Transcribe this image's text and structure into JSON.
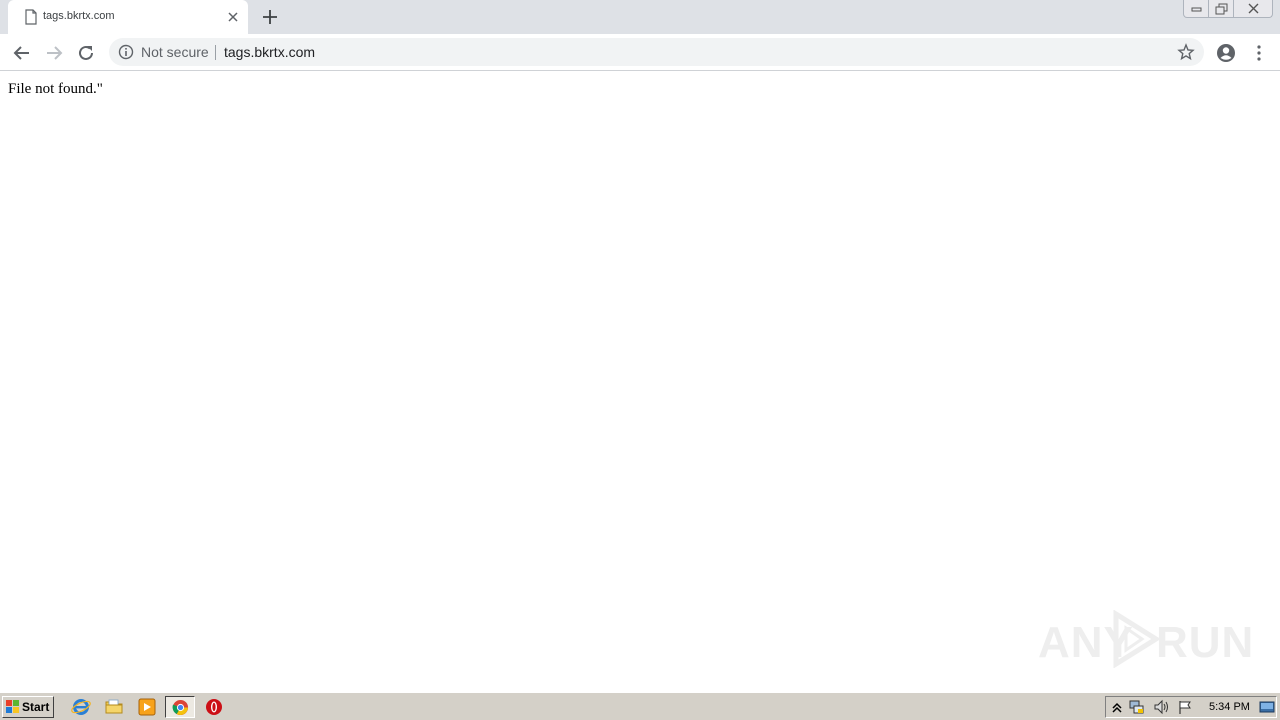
{
  "browser": {
    "tab": {
      "title": "tags.bkrtx.com"
    },
    "omnibox": {
      "security_label": "Not secure",
      "url": "tags.bkrtx.com"
    }
  },
  "page": {
    "text": "File not found.\""
  },
  "watermark": {
    "left": "ANY",
    "right": "RUN"
  },
  "taskbar": {
    "start_label": "Start",
    "clock": "5:34 PM",
    "pinned": [
      "internet-explorer-icon",
      "folder-icon",
      "media-player-icon",
      "chrome-icon",
      "opera-icon"
    ]
  },
  "colors": {
    "tabstrip": "#dee1e6",
    "omnibox": "#f1f3f4",
    "taskbar": "#d4d0c8",
    "accent_red": "#cc0f16"
  }
}
